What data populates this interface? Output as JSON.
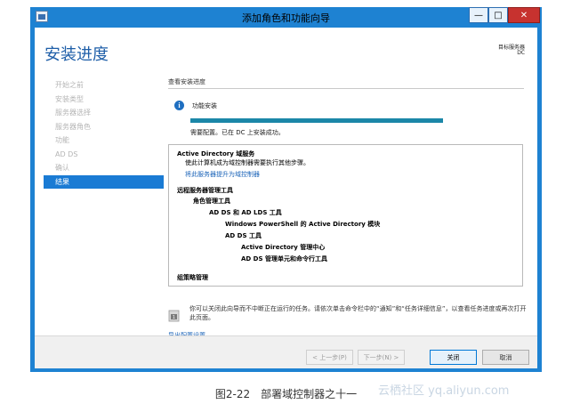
{
  "window": {
    "title": "添加角色和功能向导"
  },
  "controls": {
    "minimize": "—",
    "maximize": "□",
    "close": "✕"
  },
  "header": {
    "page_title": "安装进度",
    "target_label": "目标服务器",
    "target_value": "DC"
  },
  "nav": {
    "items": [
      {
        "label": "开始之前",
        "active": false
      },
      {
        "label": "安装类型",
        "active": false
      },
      {
        "label": "服务器选择",
        "active": false
      },
      {
        "label": "服务器角色",
        "active": false
      },
      {
        "label": "功能",
        "active": false
      },
      {
        "label": "AD DS",
        "active": false
      },
      {
        "label": "确认",
        "active": false
      },
      {
        "label": "结果",
        "active": true
      }
    ]
  },
  "main": {
    "section_title": "查看安装进度",
    "info_icon": "info-icon",
    "install_label": "功能安装",
    "progress_fraction": 1.0,
    "status": "需要配置。已在 DC 上安装成功。",
    "results": {
      "line1": "Active Directory 域服务",
      "line2": "使此计算机成为域控制器需要执行其他步骤。",
      "line3": "将此服务器提升为域控制器",
      "line4": "远程服务器管理工具",
      "line5": "角色管理工具",
      "line6": "AD DS 和 AD LDS 工具",
      "line7": "Windows PowerShell 的 Active Directory 模块",
      "line8": "AD DS 工具",
      "line9": "Active Directory 管理中心",
      "line10": "AD DS 管理单元和命令行工具",
      "line11": "组策略管理"
    },
    "note": "你可以关闭此向导而不中断正在运行的任务。请依次单击命令栏中的“通知”和“任务详细信息”，以查看任务进度或再次打开此页面。",
    "export_link": "导出配置设置"
  },
  "footer": {
    "prev": "< 上一步(P)",
    "next": "下一步(N) >",
    "close": "关闭",
    "cancel": "取消"
  },
  "caption": "图2-22　部署域控制器之十一",
  "watermark": "云栖社区 yq.aliyun.com"
}
